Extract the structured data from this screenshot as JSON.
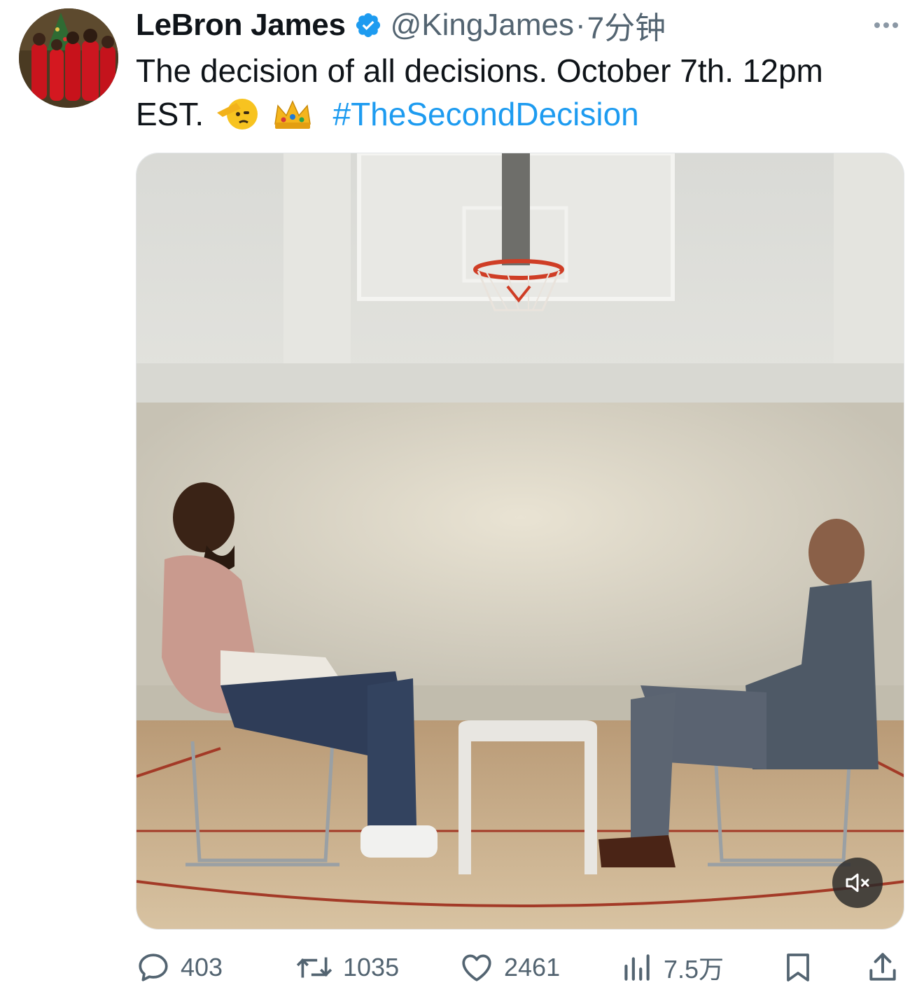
{
  "tweet": {
    "author_name": "LeBron James",
    "handle": "@KingJames",
    "separator": "·",
    "timestamp": "7分钟",
    "text_main": "The decision of all decisions. October 7th. 12pm EST.",
    "emoji_1": "🫡",
    "emoji_2": "👑",
    "hashtag": "#TheSecondDecision",
    "verified_color": "#1d9bf0",
    "link_color": "#1d9bf0"
  },
  "icons": {
    "verified": "verified-badge-icon",
    "more": "more-options-icon",
    "mute": "speaker-muted-icon",
    "reply": "comment-icon",
    "retweet": "retweet-icon",
    "like": "heart-icon",
    "views": "bar-chart-icon",
    "bookmark": "bookmark-icon",
    "share": "share-icon"
  },
  "actions": {
    "replies": "403",
    "retweets": "1035",
    "likes": "2461",
    "views": "7.5万"
  }
}
